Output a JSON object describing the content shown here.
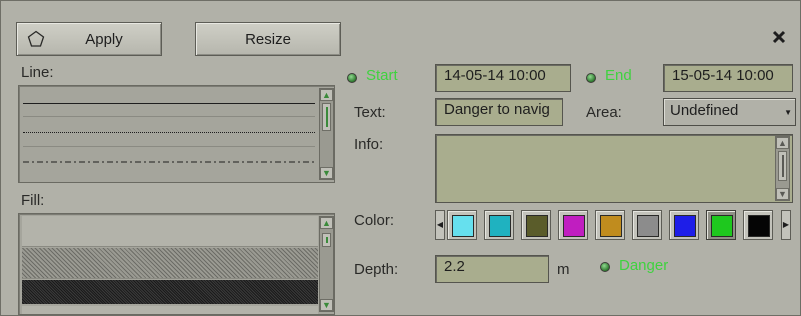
{
  "toolbar": {
    "apply_label": "Apply",
    "resize_label": "Resize"
  },
  "line": {
    "label": "Line:"
  },
  "fill": {
    "label": "Fill:"
  },
  "start": {
    "label": "Start",
    "value": "14-05-14 10:00"
  },
  "end": {
    "label": "End",
    "value": "15-05-14 10:00"
  },
  "text": {
    "label": "Text:",
    "value": "Danger to navig"
  },
  "area": {
    "label": "Area:",
    "value": "Undefined"
  },
  "info": {
    "label": "Info:",
    "value": ""
  },
  "color": {
    "label": "Color:",
    "swatches": [
      "#66e0ee",
      "#1fb2c0",
      "#5a5c2a",
      "#c01ec0",
      "#c08c1e",
      "#8c8c8c",
      "#1e1ee8",
      "#1ec81e",
      "#050505"
    ],
    "selected_index": 7
  },
  "depth": {
    "label": "Depth:",
    "value": "2.2",
    "unit": "m",
    "danger_label": "Danger"
  },
  "icons": {
    "shape": "pentagon-icon",
    "close": "close-icon",
    "dropdown": "chevron-down-icon"
  }
}
